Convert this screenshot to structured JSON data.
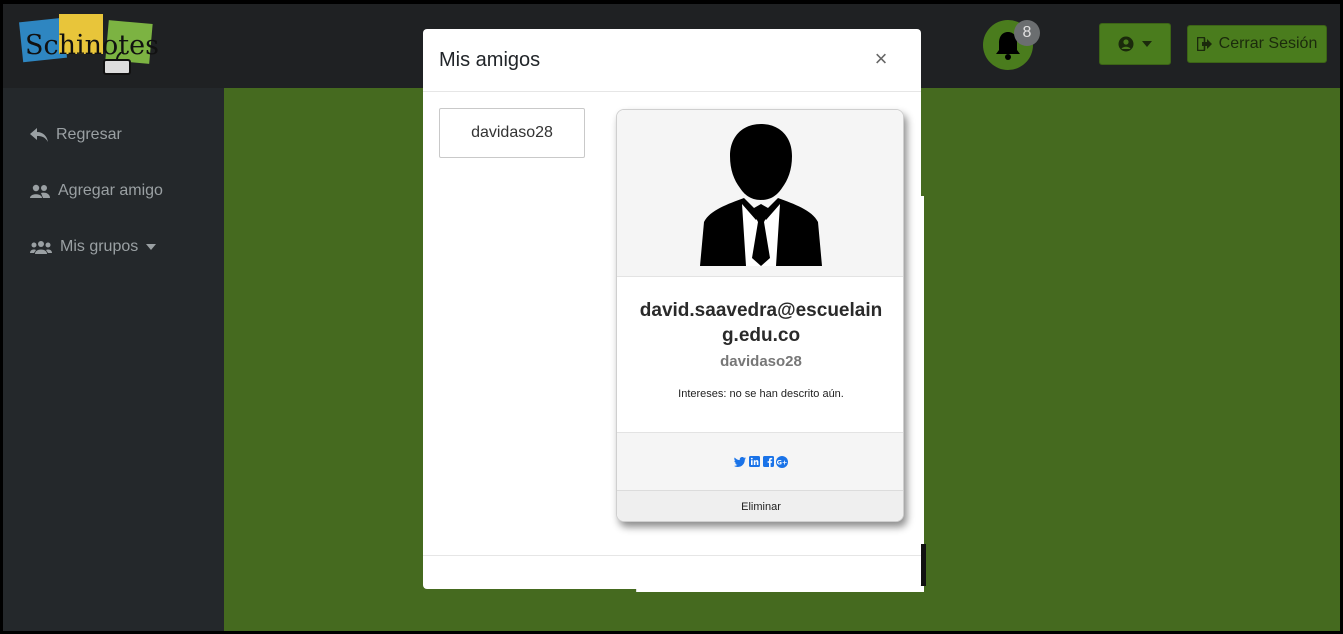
{
  "app": {
    "logo_text": "Schinotes"
  },
  "topbar": {
    "notifications_count": "8",
    "logout_label": "Cerrar Sesión"
  },
  "sidebar": {
    "items": [
      {
        "label": "Regresar",
        "icon": "reply-icon"
      },
      {
        "label": "Agregar amigo",
        "icon": "users-icon"
      },
      {
        "label": "Mis grupos",
        "icon": "user-group-icon"
      }
    ]
  },
  "modal": {
    "title": "Mis amigos",
    "close_label": "×",
    "friends": [
      {
        "label": "davidaso28"
      }
    ],
    "profile": {
      "email": "david.saavedra@escuelaing.edu.co",
      "username": "davidaso28",
      "interests": "Intereses: no se han descrito aún.",
      "delete_label": "Eliminar",
      "social_icons": [
        "twitter-icon",
        "linkedin-icon",
        "facebook-icon",
        "google-plus-icon"
      ]
    }
  },
  "colors": {
    "brand_green": "#4a7c1d",
    "content_green": "#456a1f",
    "dark_bg": "#24282b",
    "social_blue": "#1a73e8"
  }
}
